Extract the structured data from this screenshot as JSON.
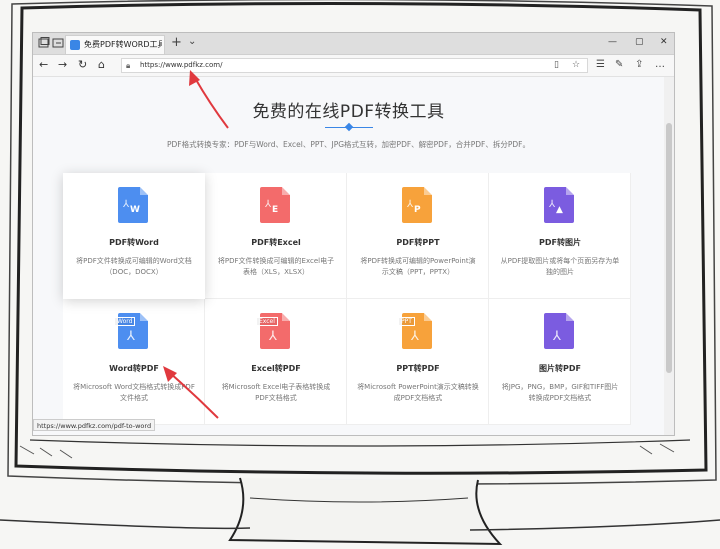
{
  "browser": {
    "tab_title": "免费PDF转WORD工具F",
    "url": "https://www.pdfkz.com/",
    "status_url": "https://www.pdfkz.com/pdf-to-word"
  },
  "page": {
    "headline": "免费的在线PDF转换工具",
    "subtitle": "PDF格式转换专家：PDF与Word、Excel、PPT、JPG格式互转，加密PDF、解密PDF，合并PDF、拆分PDF。"
  },
  "cards": [
    {
      "title": "PDF转Word",
      "desc": "将PDF文件转换成可编辑的Word文档（DOC，DOCX）",
      "icon": "word-doc-icon",
      "color": "#4d8ef0",
      "glyph": "W",
      "tag": ""
    },
    {
      "title": "PDF转Excel",
      "desc": "将PDF文件转换成可编辑的Excel电子表格（XLS，XLSX）",
      "icon": "excel-doc-icon",
      "color": "#f36b6b",
      "glyph": "E",
      "tag": ""
    },
    {
      "title": "PDF转PPT",
      "desc": "将PDF转换成可编辑的PowerPoint演示文稿（PPT，PPTX）",
      "icon": "ppt-doc-icon",
      "color": "#f7a23b",
      "glyph": "P",
      "tag": ""
    },
    {
      "title": "PDF转图片",
      "desc": "从PDF提取图片或将每个页面另存为单独的图片",
      "icon": "image-doc-icon",
      "color": "#7b5ce0",
      "glyph": "▲",
      "tag": ""
    },
    {
      "title": "Word转PDF",
      "desc": "将Microsoft Word文档格式转换成PDF文件格式",
      "icon": "word-to-pdf-icon",
      "color": "#4d8ef0",
      "glyph": "",
      "tag": "Word"
    },
    {
      "title": "Excel转PDF",
      "desc": "将Microsoft Excel电子表格转换成PDF文档格式",
      "icon": "excel-to-pdf-icon",
      "color": "#f36b6b",
      "glyph": "",
      "tag": "Excel"
    },
    {
      "title": "PPT转PDF",
      "desc": "将Microsoft PowerPoint演示文稿转换成PDF文档格式",
      "icon": "ppt-to-pdf-icon",
      "color": "#f7a23b",
      "glyph": "",
      "tag": "PPT"
    },
    {
      "title": "图片转PDF",
      "desc": "将JPG，PNG，BMP，GIF和TIFF图片转换成PDF文档格式",
      "icon": "image-to-pdf-icon",
      "color": "#7b5ce0",
      "glyph": "",
      "tag": ""
    }
  ],
  "colors": {
    "accent": "#3a86e6",
    "arrow": "#e0393e"
  }
}
